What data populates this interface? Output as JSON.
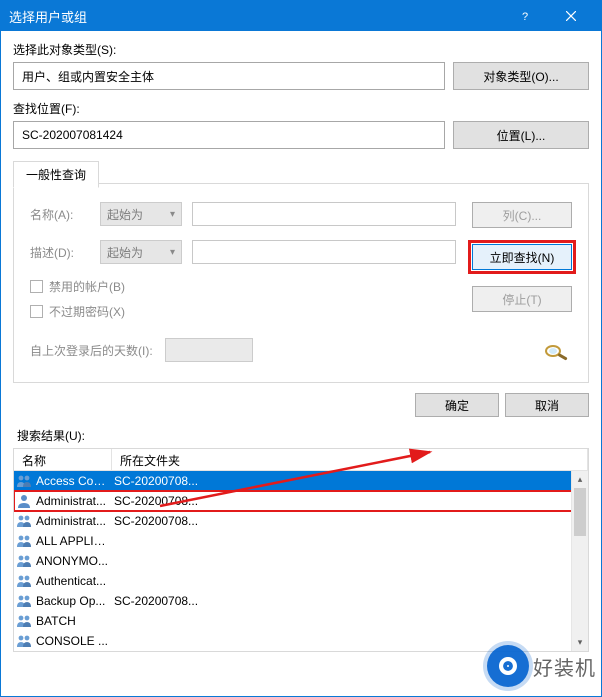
{
  "window": {
    "title": "选择用户或组"
  },
  "object_type": {
    "label": "选择此对象类型(S):",
    "value": "用户、组或内置安全主体",
    "button": "对象类型(O)..."
  },
  "location": {
    "label": "查找位置(F):",
    "value": "SC-202007081424",
    "button": "位置(L)..."
  },
  "tab": {
    "label": "一般性查询"
  },
  "query": {
    "name_label": "名称(A):",
    "name_op": "起始为",
    "desc_label": "描述(D):",
    "desc_op": "起始为",
    "chk_disabled": "禁用的帐户(B)",
    "chk_noexpire": "不过期密码(X)",
    "days_label": "自上次登录后的天数(I):"
  },
  "side": {
    "columns": "列(C)...",
    "findnow": "立即查找(N)",
    "stop": "停止(T)"
  },
  "actions": {
    "ok": "确定",
    "cancel": "取消"
  },
  "results": {
    "label": "搜索结果(U):",
    "col_name": "名称",
    "col_folder": "所在文件夹",
    "rows": [
      {
        "name": "Access Con...",
        "folder": "SC-20200708...",
        "icon": "group",
        "selected": true
      },
      {
        "name": "Administrat...",
        "folder": "SC-20200708...",
        "icon": "user",
        "boxed": true
      },
      {
        "name": "Administrat...",
        "folder": "SC-20200708...",
        "icon": "group"
      },
      {
        "name": "ALL APPLIC...",
        "folder": "",
        "icon": "group"
      },
      {
        "name": "ANONYMO...",
        "folder": "",
        "icon": "group"
      },
      {
        "name": "Authenticat...",
        "folder": "",
        "icon": "group"
      },
      {
        "name": "Backup Op...",
        "folder": "SC-20200708...",
        "icon": "group"
      },
      {
        "name": "BATCH",
        "folder": "",
        "icon": "group"
      },
      {
        "name": "CONSOLE ...",
        "folder": "",
        "icon": "group"
      }
    ]
  },
  "watermark": "好装机"
}
